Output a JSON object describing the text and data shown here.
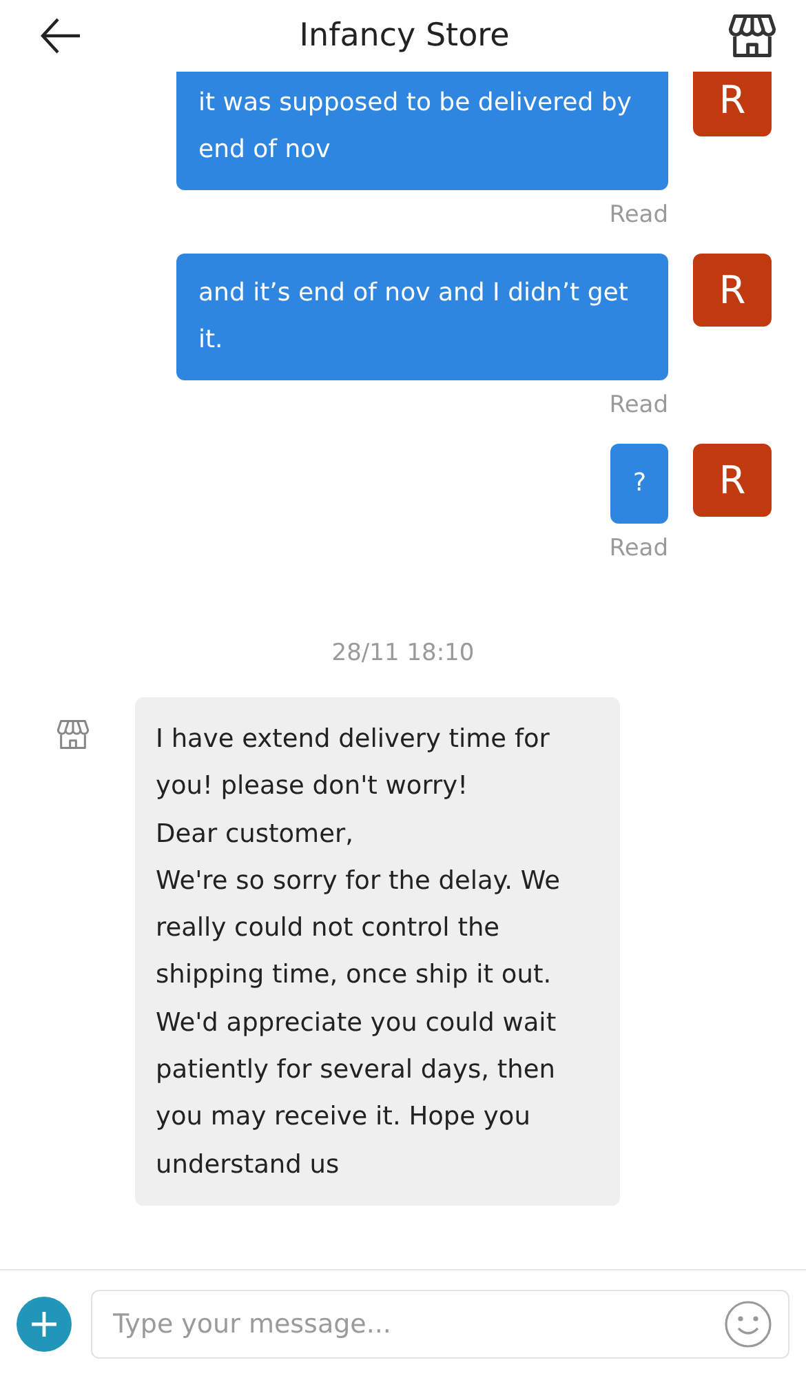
{
  "header": {
    "title": "Infancy Store"
  },
  "messages": [
    {
      "kind": "sent",
      "text": "it was supposed to be delivered by end of nov",
      "avatar": "R",
      "status": "Read"
    },
    {
      "kind": "sent",
      "text": "and it’s end of nov and I didn’t get it.",
      "avatar": "R",
      "status": "Read"
    },
    {
      "kind": "sent",
      "text": "?",
      "avatar": "R",
      "status": "Read"
    },
    {
      "kind": "time",
      "text": "28/11 18:10"
    },
    {
      "kind": "received",
      "text": "I have extend delivery time for you! please don't worry!\nDear customer,\nWe're so sorry for the delay. We really could not control the shipping time, once ship it out. We'd appreciate you could wait patiently for several days, then you may receive it. Hope you understand us"
    }
  ],
  "composer": {
    "placeholder": "Type your message..."
  }
}
